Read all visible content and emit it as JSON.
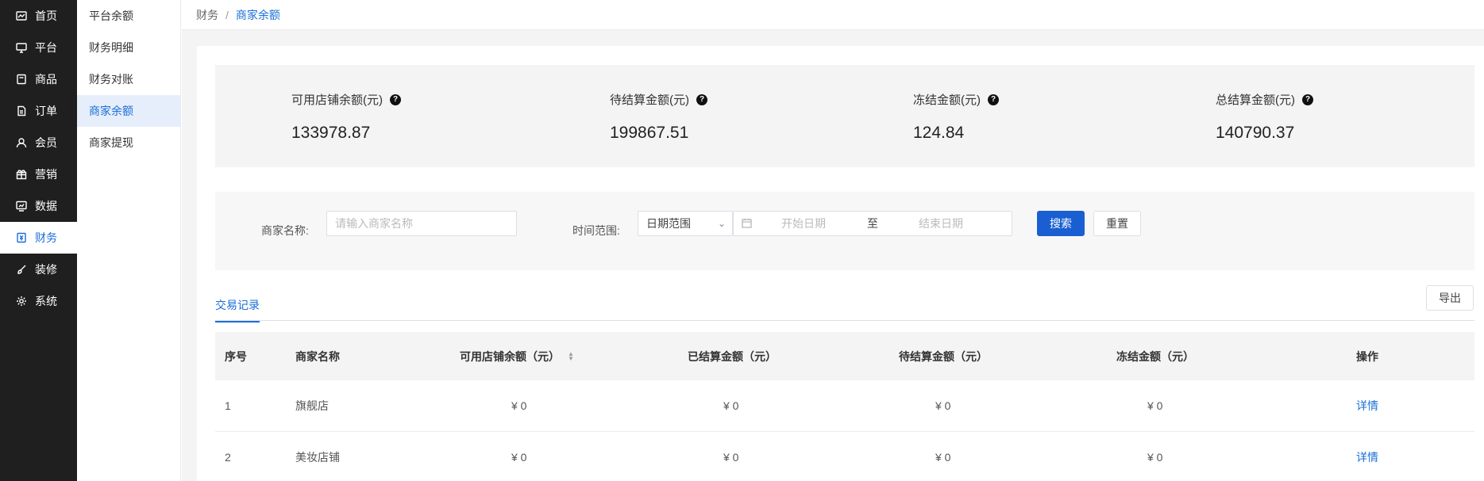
{
  "nav": {
    "items": [
      {
        "label": "首页",
        "icon": "dashboard-icon"
      },
      {
        "label": "平台",
        "icon": "monitor-icon"
      },
      {
        "label": "商品",
        "icon": "product-icon"
      },
      {
        "label": "订单",
        "icon": "order-icon"
      },
      {
        "label": "会员",
        "icon": "member-icon"
      },
      {
        "label": "营销",
        "icon": "gift-icon"
      },
      {
        "label": "数据",
        "icon": "chart-icon"
      },
      {
        "label": "财务",
        "icon": "finance-icon"
      },
      {
        "label": "装修",
        "icon": "brush-icon"
      },
      {
        "label": "系统",
        "icon": "gear-icon"
      }
    ],
    "active_index": 7
  },
  "subnav": {
    "items": [
      "平台余额",
      "财务明细",
      "财务对账",
      "商家余额",
      "商家提现"
    ],
    "active_index": 3
  },
  "breadcrumb": {
    "parent": "财务",
    "separator": "/",
    "current": "商家余额"
  },
  "stats": [
    {
      "label": "可用店铺余额(元)",
      "value": "133978.87"
    },
    {
      "label": "待结算金额(元)",
      "value": "199867.51"
    },
    {
      "label": "冻结金额(元)",
      "value": "124.84"
    },
    {
      "label": "总结算金额(元)",
      "value": "140790.37"
    }
  ],
  "help_glyph": "?",
  "filter": {
    "merchant_label": "商家名称:",
    "merchant_placeholder": "请输入商家名称",
    "time_label": "时间范围:",
    "range_select": "日期范围",
    "start_placeholder": "开始日期",
    "range_sep": "至",
    "end_placeholder": "结束日期",
    "search_button": "搜索",
    "reset_button": "重置"
  },
  "tabs": {
    "active": "交易记录"
  },
  "export_button": "导出",
  "table": {
    "headers": [
      "序号",
      "商家名称",
      "可用店铺余额（元）",
      "已结算金额（元）",
      "待结算金额（元）",
      "冻结金额（元）",
      "操作"
    ],
    "rows": [
      {
        "index": "1",
        "name": "旗舰店",
        "available": "¥ 0",
        "settled": "¥ 0",
        "pending": "¥ 0",
        "frozen": "¥ 0",
        "action": "详情"
      },
      {
        "index": "2",
        "name": "美妆店铺",
        "available": "¥ 0",
        "settled": "¥ 0",
        "pending": "¥ 0",
        "frozen": "¥ 0",
        "action": "详情"
      }
    ]
  },
  "colors": {
    "accent": "#1a6fd8",
    "sidebar_bg": "#1f1f1f",
    "primary_button": "#1a5fd1"
  }
}
